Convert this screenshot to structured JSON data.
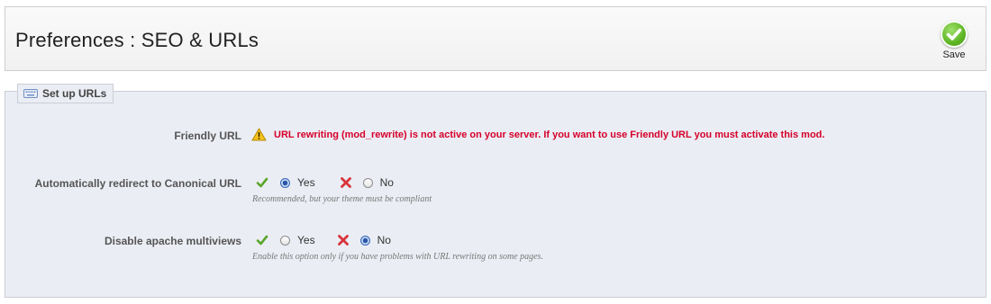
{
  "header": {
    "title": "Preferences : SEO & URLs",
    "save_label": "Save"
  },
  "panel": {
    "legend": "Set up URLs",
    "rows": [
      {
        "label": "Friendly URL",
        "warning": "URL rewriting (mod_rewrite) is not active on your server. If you want to use Friendly URL you must activate this mod."
      },
      {
        "label": "Automatically redirect to Canonical URL",
        "yes_label": "Yes",
        "no_label": "No",
        "selected": "Yes",
        "help": "Recommended, but your theme must be compliant"
      },
      {
        "label": "Disable apache multiviews",
        "yes_label": "Yes",
        "no_label": "No",
        "selected": "No",
        "help": "Enable this option only if you have problems with URL rewriting on some pages."
      }
    ]
  },
  "colors": {
    "warning": "#d6002a",
    "panel_bg": "#ebedf4",
    "check": "#5aa62a",
    "cross": "#d8333a",
    "save": "#5db523"
  },
  "icons": {
    "save": "check-circle-icon",
    "legend": "keyboard-icon",
    "warning": "warning-triangle-icon",
    "yes": "check-icon",
    "no": "cross-icon"
  }
}
